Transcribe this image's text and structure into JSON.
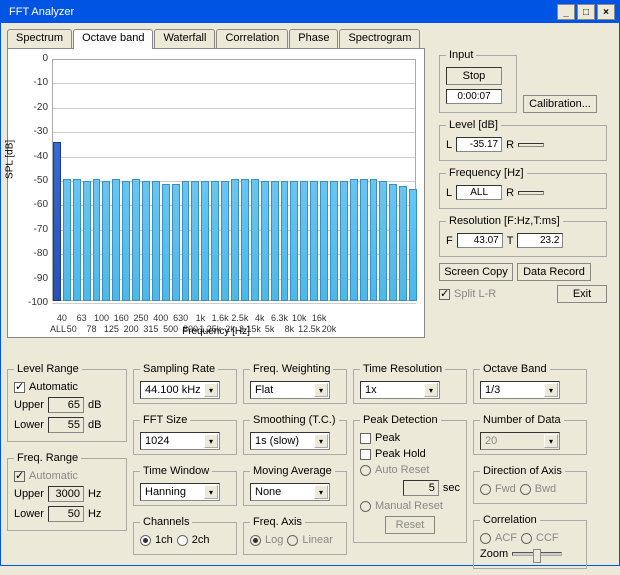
{
  "title": "FFT Analyzer",
  "winctl": {
    "min": "_",
    "max": "□",
    "close": "×"
  },
  "tabs": [
    "Spectrum",
    "Octave band",
    "Waterfall",
    "Correlation",
    "Phase",
    "Spectrogram"
  ],
  "active_tab_index": 1,
  "input": {
    "legend": "Input",
    "stop": "Stop",
    "time": "0:00:07",
    "calibration": "Calibration..."
  },
  "level": {
    "legend": "Level [dB]",
    "L": "L",
    "Lv": "-35.17",
    "R": "R",
    "Rv": ""
  },
  "frequency": {
    "legend": "Frequency [Hz]",
    "L": "L",
    "Lv": "ALL",
    "R": "R",
    "Rv": ""
  },
  "resolution": {
    "legend": "Resolution [F:Hz,T:ms]",
    "F": "F",
    "Fv": "43.07",
    "T": "T",
    "Tv": "23.2"
  },
  "buttons": {
    "screen_copy": "Screen Copy",
    "data_record": "Data Record",
    "exit": "Exit"
  },
  "split_lr": "Split L-R",
  "level_range": {
    "legend": "Level Range",
    "auto": "Automatic",
    "upper": "Upper",
    "upper_v": "65",
    "upper_u": "dB",
    "lower": "Lower",
    "lower_v": "55",
    "lower_u": "dB"
  },
  "freq_range": {
    "legend": "Freq. Range",
    "auto": "Automatic",
    "upper": "Upper",
    "upper_v": "3000",
    "upper_u": "Hz",
    "lower": "Lower",
    "lower_v": "50",
    "lower_u": "Hz"
  },
  "sampling_rate": {
    "legend": "Sampling Rate",
    "value": "44.100 kHz"
  },
  "fft_size": {
    "legend": "FFT Size",
    "value": "1024"
  },
  "time_window": {
    "legend": "Time Window",
    "value": "Hanning"
  },
  "channels": {
    "legend": "Channels",
    "opt1": "1ch",
    "opt2": "2ch"
  },
  "freq_weighting": {
    "legend": "Freq. Weighting",
    "value": "Flat"
  },
  "smoothing": {
    "legend": "Smoothing (T.C.)",
    "value": "1s (slow)"
  },
  "moving_avg": {
    "legend": "Moving Average",
    "value": "None"
  },
  "freq_axis": {
    "legend": "Freq. Axis",
    "opt1": "Log",
    "opt2": "Linear"
  },
  "time_res": {
    "legend": "Time Resolution",
    "value": "1x"
  },
  "peak": {
    "legend": "Peak Detection",
    "peak": "Peak",
    "hold": "Peak Hold",
    "auto": "Auto Reset",
    "sec_v": "5",
    "sec": "sec",
    "manual": "Manual Reset",
    "reset": "Reset"
  },
  "octave_band": {
    "legend": "Octave Band",
    "value": "1/3"
  },
  "num_data": {
    "legend": "Number of Data",
    "value": "20"
  },
  "dir_axis": {
    "legend": "Direction of Axis",
    "fwd": "Fwd",
    "bwd": "Bwd"
  },
  "correlation": {
    "legend": "Correlation",
    "acf": "ACF",
    "ccf": "CCF",
    "zoom": "Zoom"
  },
  "chart_data": {
    "type": "bar",
    "title": "",
    "xlabel": "Frequency [Hz]",
    "ylabel": "SPL [dB]",
    "ylim": [
      -100,
      0
    ],
    "xticks_top": [
      "40",
      "63",
      "100",
      "160",
      "250",
      "400",
      "630",
      "1k",
      "1.6k",
      "2.5k",
      "4k",
      "6.3k",
      "10k",
      "16k"
    ],
    "xticks_bot": [
      "ALL",
      "50",
      "78",
      "125",
      "200",
      "315",
      "500",
      "800",
      "1.25k",
      "2k",
      "3.15k",
      "5k",
      "8k",
      "12.5k",
      "20k"
    ],
    "yticks": [
      0,
      -10,
      -20,
      -30,
      -40,
      -50,
      -60,
      -70,
      -80,
      -90,
      -100
    ],
    "values": [
      -35,
      -50,
      -50,
      -51,
      -50,
      -51,
      -50,
      -51,
      -50,
      -51,
      -51,
      -52,
      -52,
      -51,
      -51,
      -51,
      -51,
      -51,
      -50,
      -50,
      -50,
      -51,
      -51,
      -51,
      -51,
      -51,
      -51,
      -51,
      -51,
      -51,
      -50,
      -50,
      -50,
      -51,
      -52,
      -53,
      -54
    ]
  }
}
